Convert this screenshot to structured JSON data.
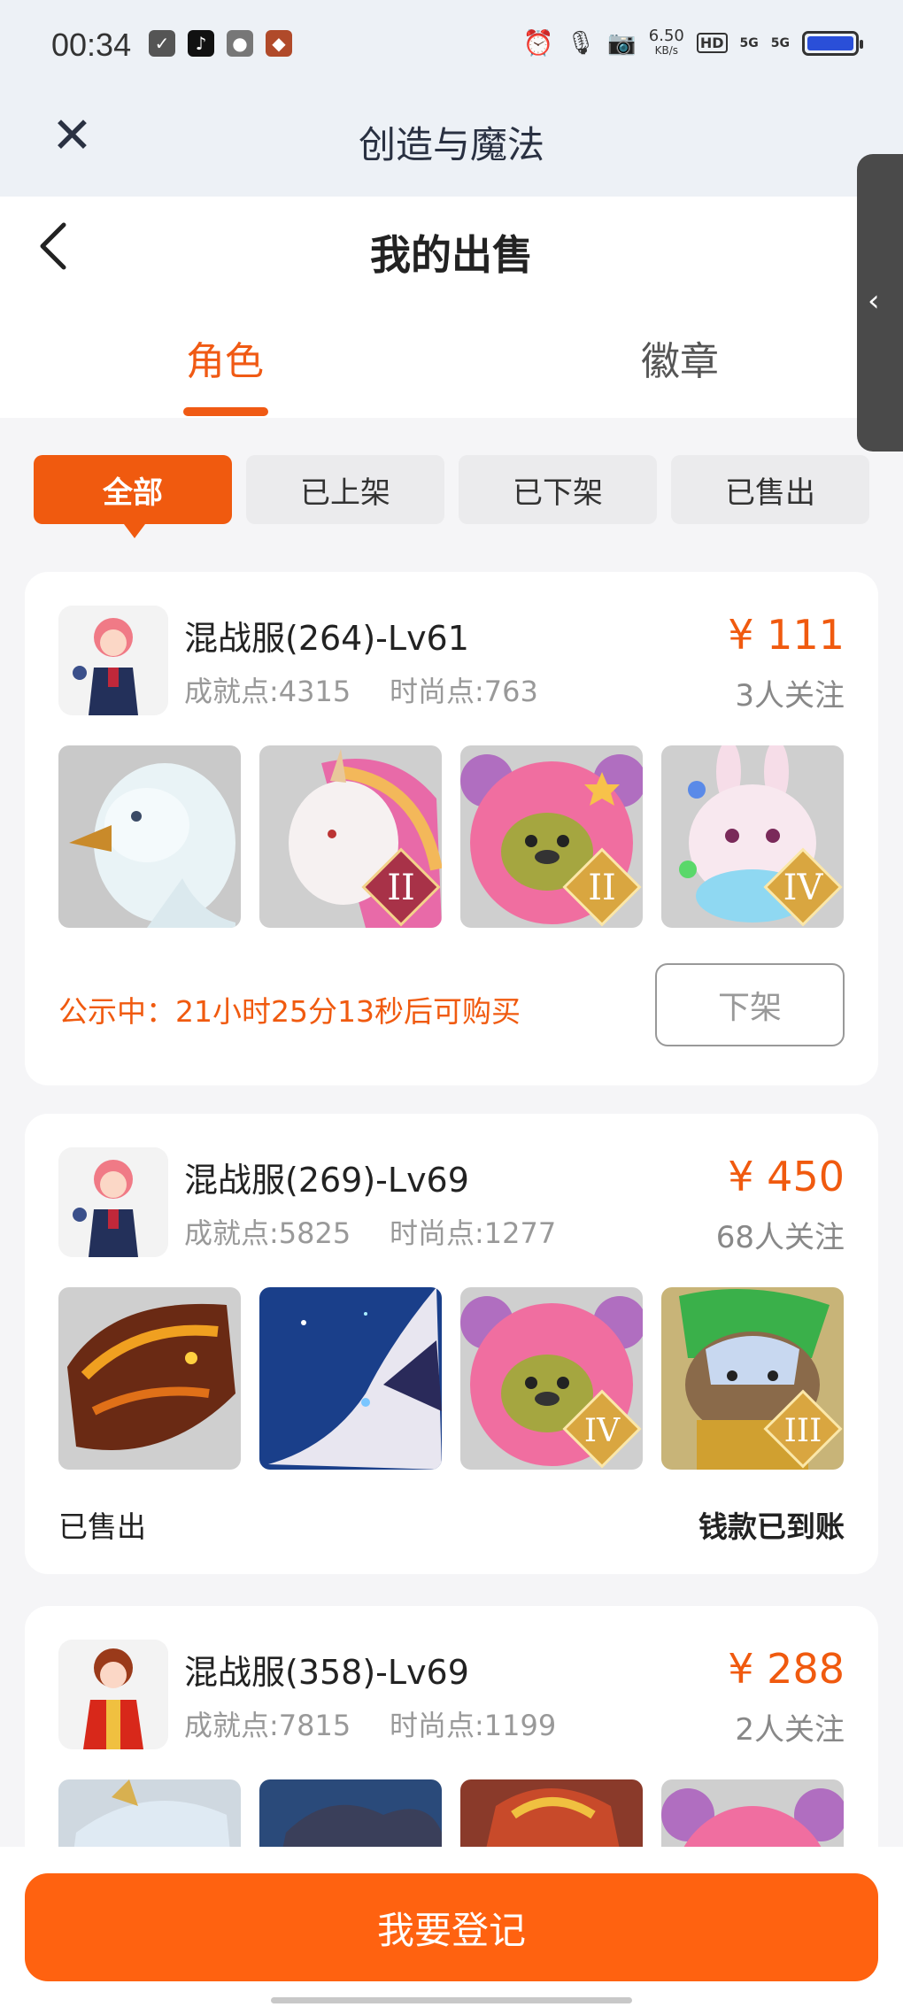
{
  "status_bar": {
    "time": "00:34",
    "net_speed": "6.50",
    "net_unit": "KB/s",
    "hd": "HD",
    "sig1": "5G",
    "sig2": "5G"
  },
  "app_header": {
    "title": "创造与魔法"
  },
  "page": {
    "title": "我的出售"
  },
  "tabs": {
    "active": "角色",
    "inactive": "徽章"
  },
  "filters": [
    "全部",
    "已上架",
    "已下架",
    "已售出"
  ],
  "cards": [
    {
      "server": "混战服(264)-Lv61",
      "achievement": "成就点:4315",
      "fashion": "时尚点:763",
      "price": "¥ 111",
      "followers": "3人关注",
      "items": [
        {
          "name": "eagle-mount",
          "tier": ""
        },
        {
          "name": "unicorn-mount",
          "tier": "II"
        },
        {
          "name": "pink-bear-mount",
          "tier": "II"
        },
        {
          "name": "bunny-mount",
          "tier": "IV"
        }
      ],
      "notice": "公示中：21小时25分13秒后可购买",
      "action": "下架"
    },
    {
      "server": "混战服(269)-Lv69",
      "achievement": "成就点:5825",
      "fashion": "时尚点:1277",
      "price": "¥ 450",
      "followers": "68人关注",
      "items": [
        {
          "name": "fire-dragon-mount",
          "tier": ""
        },
        {
          "name": "star-wolf-mount",
          "tier": ""
        },
        {
          "name": "pink-bear-mount",
          "tier": "IV"
        },
        {
          "name": "beast-king-mount",
          "tier": "III"
        }
      ],
      "status": "已售出",
      "payment": "钱款已到账"
    },
    {
      "server": "混战服(358)-Lv69",
      "achievement": "成就点:7815",
      "fashion": "时尚点:1199",
      "price": "¥ 288",
      "followers": "2人关注"
    }
  ],
  "bottom": {
    "register": "我要登记"
  },
  "colors": {
    "accent": "#f05a0f",
    "button": "#ff6210",
    "background": "#f5f5f7"
  }
}
